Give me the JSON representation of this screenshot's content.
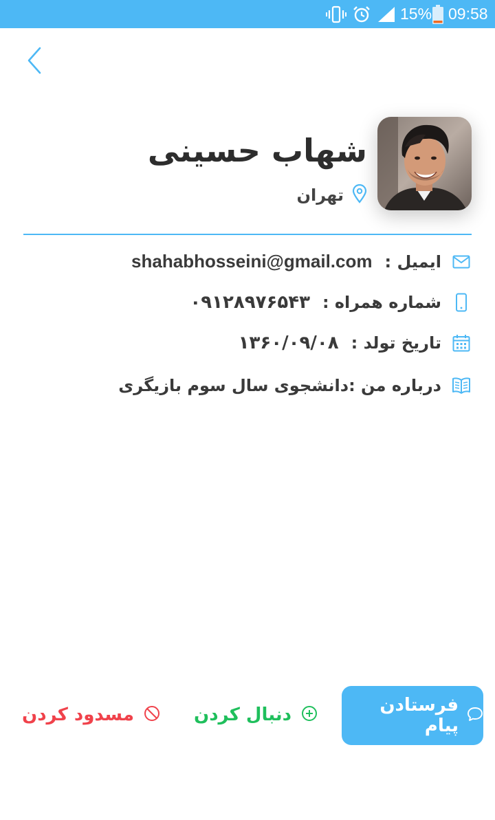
{
  "status_bar": {
    "battery_percent": "15%",
    "time": "09:58",
    "icons": [
      "vibrate-icon",
      "alarm-icon",
      "signal-icon",
      "battery-icon"
    ],
    "background_color": "#4db8f5"
  },
  "header": {
    "back_icon": "chevron-left-icon"
  },
  "profile": {
    "name": "شهاب حسینی",
    "location": "تهران",
    "avatar": "profile-photo"
  },
  "details": {
    "email_label": "ایمیل :",
    "email_value": "shahabhosseini@gmail.com",
    "phone_label": "شماره همراه :",
    "phone_value": "۰۹۱۲۸۹۷۶۵۴۳",
    "birth_label": "تاریخ تولد :",
    "birth_value": "۱۳۶۰/۰۹/۰۸",
    "about_text": "درباره من :دانشجوی سال سوم بازیگری"
  },
  "actions": {
    "send_message": "فرستادن پیام",
    "follow": "دنبال کردن",
    "block": "مسدود کردن"
  },
  "colors": {
    "accent": "#4db8f5",
    "follow": "#1fbf5c",
    "block": "#f0424b"
  }
}
